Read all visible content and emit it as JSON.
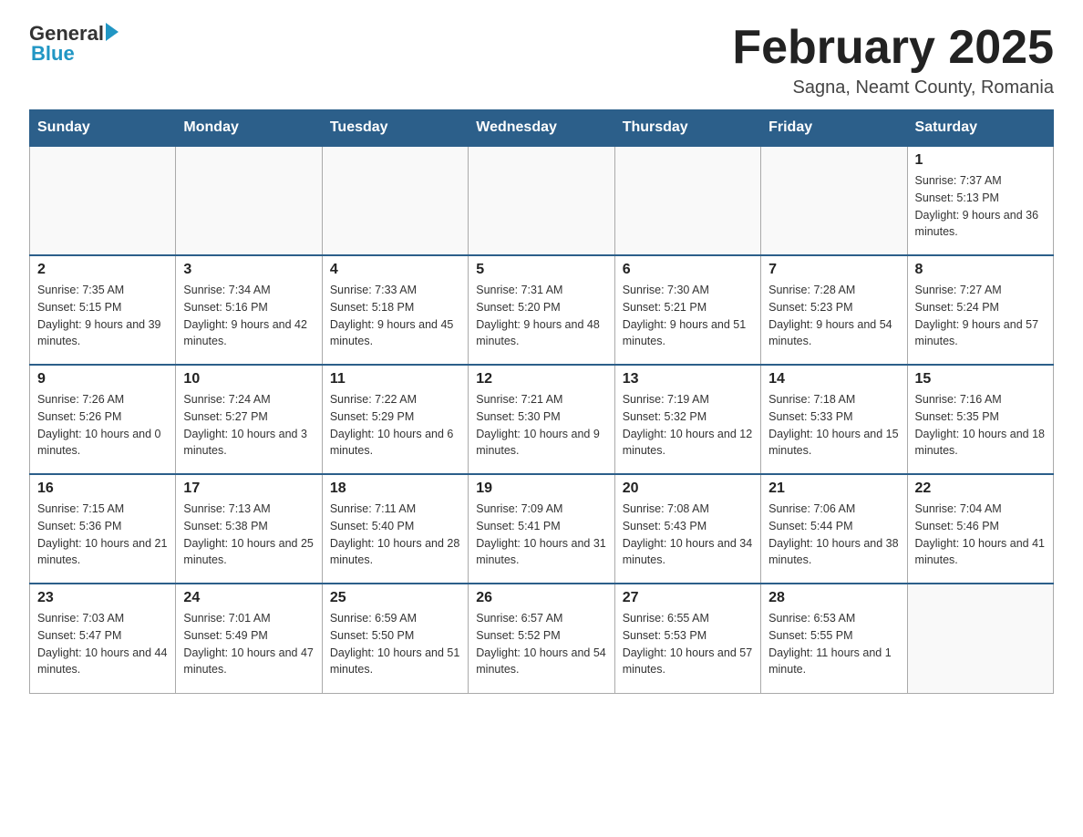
{
  "header": {
    "logo": {
      "general": "General",
      "blue": "Blue"
    },
    "title": "February 2025",
    "location": "Sagna, Neamt County, Romania"
  },
  "calendar": {
    "days_of_week": [
      "Sunday",
      "Monday",
      "Tuesday",
      "Wednesday",
      "Thursday",
      "Friday",
      "Saturday"
    ],
    "weeks": [
      [
        {
          "day": "",
          "info": ""
        },
        {
          "day": "",
          "info": ""
        },
        {
          "day": "",
          "info": ""
        },
        {
          "day": "",
          "info": ""
        },
        {
          "day": "",
          "info": ""
        },
        {
          "day": "",
          "info": ""
        },
        {
          "day": "1",
          "info": "Sunrise: 7:37 AM\nSunset: 5:13 PM\nDaylight: 9 hours and 36 minutes."
        }
      ],
      [
        {
          "day": "2",
          "info": "Sunrise: 7:35 AM\nSunset: 5:15 PM\nDaylight: 9 hours and 39 minutes."
        },
        {
          "day": "3",
          "info": "Sunrise: 7:34 AM\nSunset: 5:16 PM\nDaylight: 9 hours and 42 minutes."
        },
        {
          "day": "4",
          "info": "Sunrise: 7:33 AM\nSunset: 5:18 PM\nDaylight: 9 hours and 45 minutes."
        },
        {
          "day": "5",
          "info": "Sunrise: 7:31 AM\nSunset: 5:20 PM\nDaylight: 9 hours and 48 minutes."
        },
        {
          "day": "6",
          "info": "Sunrise: 7:30 AM\nSunset: 5:21 PM\nDaylight: 9 hours and 51 minutes."
        },
        {
          "day": "7",
          "info": "Sunrise: 7:28 AM\nSunset: 5:23 PM\nDaylight: 9 hours and 54 minutes."
        },
        {
          "day": "8",
          "info": "Sunrise: 7:27 AM\nSunset: 5:24 PM\nDaylight: 9 hours and 57 minutes."
        }
      ],
      [
        {
          "day": "9",
          "info": "Sunrise: 7:26 AM\nSunset: 5:26 PM\nDaylight: 10 hours and 0 minutes."
        },
        {
          "day": "10",
          "info": "Sunrise: 7:24 AM\nSunset: 5:27 PM\nDaylight: 10 hours and 3 minutes."
        },
        {
          "day": "11",
          "info": "Sunrise: 7:22 AM\nSunset: 5:29 PM\nDaylight: 10 hours and 6 minutes."
        },
        {
          "day": "12",
          "info": "Sunrise: 7:21 AM\nSunset: 5:30 PM\nDaylight: 10 hours and 9 minutes."
        },
        {
          "day": "13",
          "info": "Sunrise: 7:19 AM\nSunset: 5:32 PM\nDaylight: 10 hours and 12 minutes."
        },
        {
          "day": "14",
          "info": "Sunrise: 7:18 AM\nSunset: 5:33 PM\nDaylight: 10 hours and 15 minutes."
        },
        {
          "day": "15",
          "info": "Sunrise: 7:16 AM\nSunset: 5:35 PM\nDaylight: 10 hours and 18 minutes."
        }
      ],
      [
        {
          "day": "16",
          "info": "Sunrise: 7:15 AM\nSunset: 5:36 PM\nDaylight: 10 hours and 21 minutes."
        },
        {
          "day": "17",
          "info": "Sunrise: 7:13 AM\nSunset: 5:38 PM\nDaylight: 10 hours and 25 minutes."
        },
        {
          "day": "18",
          "info": "Sunrise: 7:11 AM\nSunset: 5:40 PM\nDaylight: 10 hours and 28 minutes."
        },
        {
          "day": "19",
          "info": "Sunrise: 7:09 AM\nSunset: 5:41 PM\nDaylight: 10 hours and 31 minutes."
        },
        {
          "day": "20",
          "info": "Sunrise: 7:08 AM\nSunset: 5:43 PM\nDaylight: 10 hours and 34 minutes."
        },
        {
          "day": "21",
          "info": "Sunrise: 7:06 AM\nSunset: 5:44 PM\nDaylight: 10 hours and 38 minutes."
        },
        {
          "day": "22",
          "info": "Sunrise: 7:04 AM\nSunset: 5:46 PM\nDaylight: 10 hours and 41 minutes."
        }
      ],
      [
        {
          "day": "23",
          "info": "Sunrise: 7:03 AM\nSunset: 5:47 PM\nDaylight: 10 hours and 44 minutes."
        },
        {
          "day": "24",
          "info": "Sunrise: 7:01 AM\nSunset: 5:49 PM\nDaylight: 10 hours and 47 minutes."
        },
        {
          "day": "25",
          "info": "Sunrise: 6:59 AM\nSunset: 5:50 PM\nDaylight: 10 hours and 51 minutes."
        },
        {
          "day": "26",
          "info": "Sunrise: 6:57 AM\nSunset: 5:52 PM\nDaylight: 10 hours and 54 minutes."
        },
        {
          "day": "27",
          "info": "Sunrise: 6:55 AM\nSunset: 5:53 PM\nDaylight: 10 hours and 57 minutes."
        },
        {
          "day": "28",
          "info": "Sunrise: 6:53 AM\nSunset: 5:55 PM\nDaylight: 11 hours and 1 minute."
        },
        {
          "day": "",
          "info": ""
        }
      ]
    ]
  }
}
